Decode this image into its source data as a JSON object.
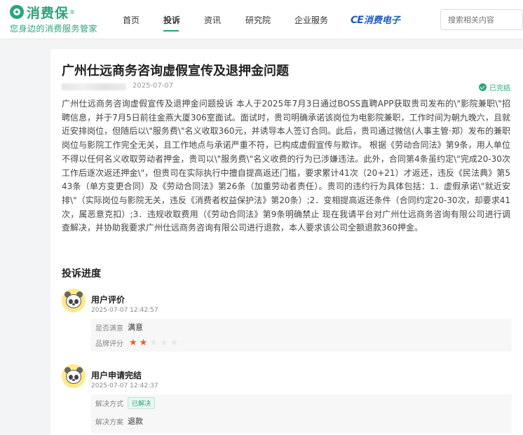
{
  "brand": {
    "name": "消费保",
    "registered": "®",
    "slogan": "您身边的消费服务管家"
  },
  "nav": {
    "items": [
      {
        "label": "首页",
        "active": false
      },
      {
        "label": "投诉",
        "active": true
      },
      {
        "label": "资讯",
        "active": false
      },
      {
        "label": "研究院",
        "active": false
      },
      {
        "label": "企业服务",
        "active": false
      }
    ],
    "partner": {
      "mark": "CE",
      "label": "消费电子"
    }
  },
  "search": {
    "placeholder": "搜索相关内容"
  },
  "complaint": {
    "title": "广州仕远商务咨询虚假宣传及退押金问题",
    "date": "2025-07-07",
    "status": "已完结",
    "body": "广州仕远商务咨询虚假宣传及退押金问题投诉 本人于2025年7月3日通过BOSS直聘APP获取贵司发布的\\\"影院兼职\\\"招聘信息，并于7月5日前往金燕大厦306室面试。面试时，贵司明确承诺该岗位为电影院兼职，工作时间为朝九晚六，且就近安排岗位，但随后以\\\"服务费\\\"名义收取360元，并诱导本人签订合同。此后，贵司通过微信(人事主管·郑）发布的兼职岗位与影院工作完全无关，且工作地点与承诺严重不符，已构成虚假宣传与欺诈。 根据《劳动合同法》第9条，用人单位不得以任何名义收取劳动者押金，贵司以\\\"服务费\\\"名义收费的行为已涉嫌违法。此外，合同第4条虽约定\\\"完成20-30次工作后逐次返还押金\\\"，但贵司在实际执行中擅自提高返还门槛，要求累计41次（20+21）才返还，违反《民法典》第543条（单方变更合同）及《劳动合同法》第26条（加重劳动者责任）。贵司的违约行为具体包括：1．虚假承诺\\\"就近安排\\\"（实际岗位与影院无关，违反《消费者权益保护法》第20条）;2．变相提高返还条件（合同约定20-30次，却要求41次，属恶意克扣）;3．违规收取费用（《劳动合同法》第9条明确禁止 现在我请平台对广州仕远商务咨询有限公司进行调查解决，并协助我要求广州仕远商务咨询有限公司进行退款，本人要求该公司全额退款360押金。"
  },
  "progress": {
    "title": "投诉进度",
    "entries": [
      {
        "title": "用户评价",
        "time": "2025-07-07 12:42:57",
        "satisfied_label": "是否满意",
        "satisfied_value": "满意",
        "rating_label": "品牌评分",
        "rating": 2,
        "rating_max": 5
      },
      {
        "title": "用户申请完结",
        "time": "2025-07-07 12:42:37",
        "method_label": "解决方式",
        "method_value": "已解决",
        "plan_label": "解决方案",
        "plan_value": "退款"
      }
    ]
  },
  "colors": {
    "brand_green": "#2aa57a",
    "star_active": "#f05a23",
    "partner_blue": "#1e5bbf"
  }
}
